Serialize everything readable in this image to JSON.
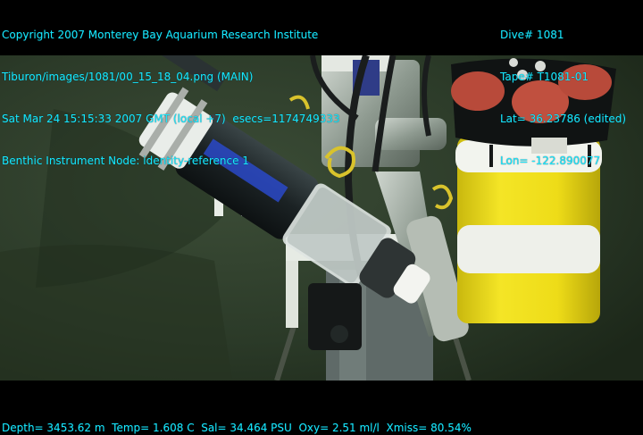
{
  "overlay": {
    "top_left": [
      "Copyright 2007 Monterey Bay Aquarium Research Institute",
      "Tiburon/images/1081/00_15_18_04.png (MAIN)",
      "Sat Mar 24 15:15:33 2007 GMT (local +7)  esecs=1174749333",
      "Benthic Instrument Node: identity-reference 1"
    ],
    "top_right": [
      "Dive# 1081",
      "Tape# T1081-01",
      "Lat= 36.23786 (edited)",
      "Lon= -122.890077"
    ],
    "bottom": "Depth= 3453.62 m  Temp= 1.608 C  Sal= 34.464 PSU  Oxy= 2.51 ml/l  Xmiss= 80.54%"
  },
  "colors": {
    "overlay_text": "#17e8ff",
    "letterbox": "#000000",
    "seafloor": "#2c3a29",
    "float_yellow": "#f2e21a"
  }
}
